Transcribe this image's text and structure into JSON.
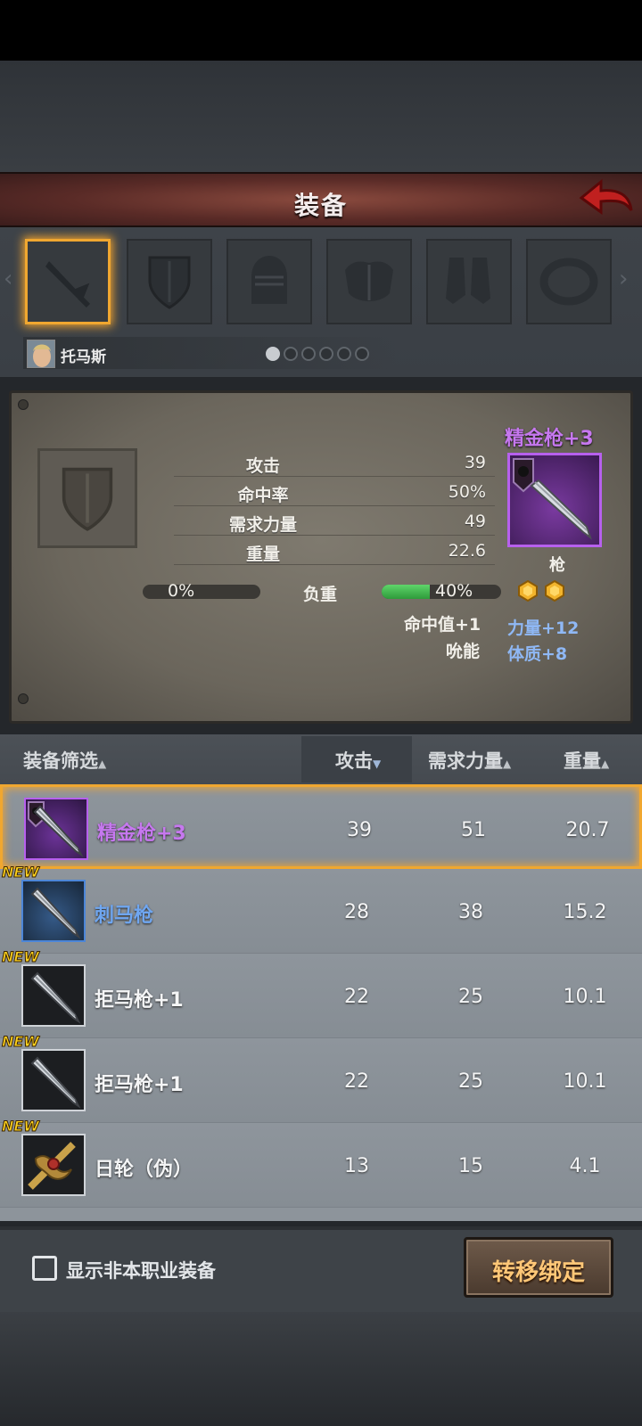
{
  "header": {
    "title": "装备"
  },
  "character": {
    "name": "托马斯",
    "page_dots": 6,
    "active_dot": 0
  },
  "slots": [
    {
      "name": "weapon",
      "icon": "sword-icon",
      "active": true
    },
    {
      "name": "shield",
      "icon": "shield-icon",
      "active": false
    },
    {
      "name": "helmet",
      "icon": "helmet-icon",
      "active": false
    },
    {
      "name": "armor",
      "icon": "armor-icon",
      "active": false
    },
    {
      "name": "boots",
      "icon": "boots-icon",
      "active": false
    },
    {
      "name": "ring",
      "icon": "ring-icon",
      "active": false
    }
  ],
  "detail": {
    "stats": [
      {
        "label": "攻击",
        "value": "39"
      },
      {
        "label": "命中率",
        "value": "50%"
      },
      {
        "label": "需求力量",
        "value": "49"
      },
      {
        "label": "重量",
        "value": "22.6"
      }
    ],
    "load": {
      "label": "负重",
      "left_text": "0%",
      "right_text": "40%",
      "right_fraction": 0.4
    },
    "bonus_left": [
      "命中值+1",
      "吮能"
    ],
    "bonus_right": [
      "力量+12",
      "体质+8"
    ],
    "item_name": "精金枪+3",
    "item_type": "枪",
    "gems": 2
  },
  "sort": {
    "filter_label": "装备筛选",
    "col_attack": "攻击",
    "col_strength": "需求力量",
    "col_weight": "重量"
  },
  "items": [
    {
      "name": "精金枪+3",
      "attack": "39",
      "strength": "51",
      "weight": "20.7",
      "new": false,
      "selected": true,
      "rarity": "purple",
      "name_color": "#c678ef"
    },
    {
      "name": "刺马枪",
      "attack": "28",
      "strength": "38",
      "weight": "15.2",
      "new": true,
      "selected": false,
      "rarity": "blue",
      "name_color": "#6fa6f0"
    },
    {
      "name": "拒马枪+1",
      "attack": "22",
      "strength": "25",
      "weight": "10.1",
      "new": true,
      "selected": false,
      "rarity": "white",
      "name_color": "#f4f5f6"
    },
    {
      "name": "拒马枪+1",
      "attack": "22",
      "strength": "25",
      "weight": "10.1",
      "new": true,
      "selected": false,
      "rarity": "white",
      "name_color": "#f4f5f6"
    },
    {
      "name": "日轮（伪）",
      "attack": "13",
      "strength": "15",
      "weight": "4.1",
      "new": true,
      "selected": false,
      "rarity": "white",
      "name_color": "#f4f5f6"
    }
  ],
  "new_label": "NEW",
  "footer": {
    "checkbox_label": "显示非本职业装备",
    "checked": false,
    "bind_button": "转移绑定"
  },
  "colors": {
    "accent": "#f0a730",
    "purple": "#c678ef",
    "blue": "#6fa6f0",
    "header": "#6e3832"
  }
}
